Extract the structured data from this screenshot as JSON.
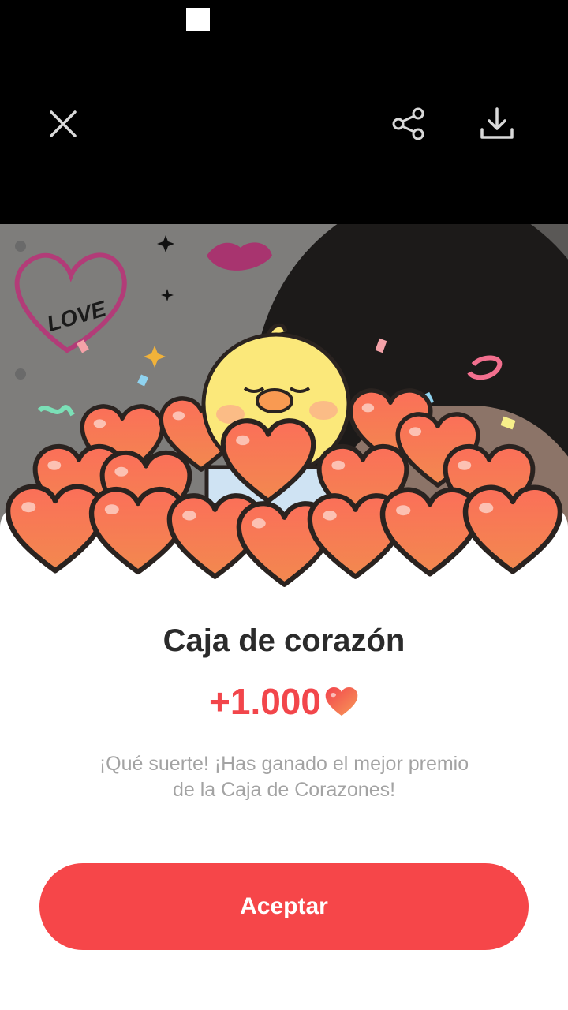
{
  "toolbar": {
    "close_icon": "close-icon",
    "share_icon": "share-icon",
    "download_icon": "download-icon"
  },
  "decorations": {
    "love_text": "LOVE"
  },
  "card": {
    "title": "Caja de corazón",
    "reward": "+1.000",
    "reward_icon": "heart-icon",
    "message": "¡Qué suerte! ¡Has ganado el mejor premio de la Caja de Corazones!",
    "accept_label": "Aceptar"
  },
  "colors": {
    "accent": "#f64649",
    "reward_text": "#f2464b",
    "heart": "#f9634f",
    "chick": "#fbe87a"
  }
}
